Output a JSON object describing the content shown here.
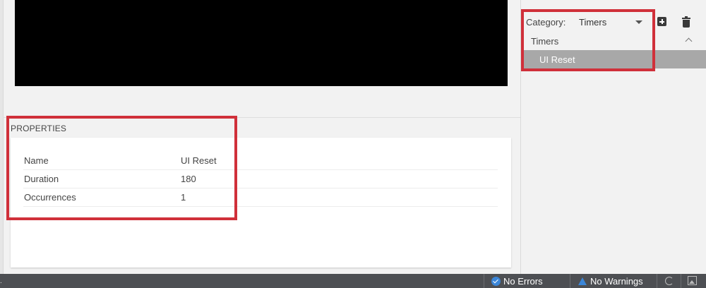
{
  "sidebar": {
    "category_label": "Category:",
    "category_value": "Timers",
    "add_icon": "add-square-icon",
    "delete_icon": "trash-icon",
    "group": {
      "label": "Timers",
      "expanded": true
    },
    "items": [
      {
        "label": "UI Reset",
        "selected": true
      }
    ]
  },
  "properties": {
    "title": "PROPERTIES",
    "rows": [
      {
        "key": "Name",
        "value": "UI Reset"
      },
      {
        "key": "Duration",
        "value": "180"
      },
      {
        "key": "Occurrences",
        "value": "1"
      }
    ]
  },
  "status": {
    "errors": "No Errors",
    "warnings": "No Warnings",
    "errors_icon": "check-circle-icon",
    "warnings_icon": "warning-triangle-icon",
    "refresh_icon": "refresh-icon",
    "image_icon": "image-icon",
    "dot": "."
  },
  "colors": {
    "highlight": "#d0303a",
    "selected_row": "#a8a8a8",
    "status_bar": "#4d4f53",
    "status_icon": "#3b86d8"
  }
}
